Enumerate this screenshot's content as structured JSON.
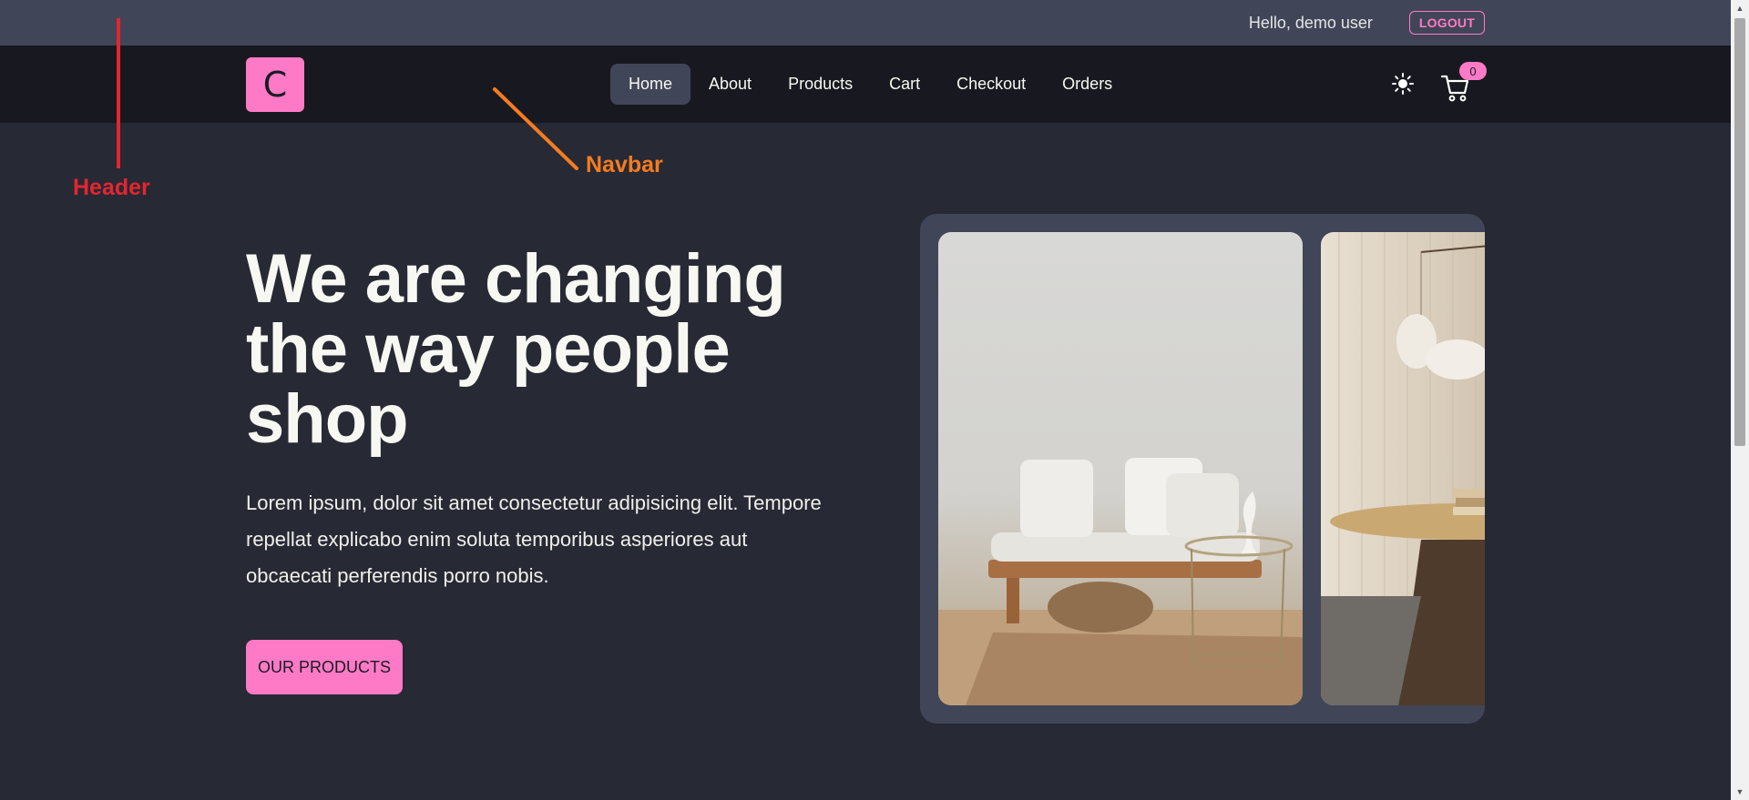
{
  "header": {
    "greeting": "Hello, demo user",
    "logout_label": "LOGOUT"
  },
  "navbar": {
    "logo_letter": "C",
    "links": [
      {
        "label": "Home",
        "active": true
      },
      {
        "label": "About"
      },
      {
        "label": "Products"
      },
      {
        "label": "Cart"
      },
      {
        "label": "Checkout"
      },
      {
        "label": "Orders"
      }
    ],
    "theme_icon": "sun-icon",
    "cart_icon": "cart-icon",
    "cart_count": "0"
  },
  "annotations": {
    "header_label": "Header",
    "navbar_label": "Navbar",
    "header_color": "#e3262f",
    "navbar_color": "#f47c20"
  },
  "hero": {
    "title": "We are changing the way people shop",
    "text": "Lorem ipsum, dolor sit amet consectetur adipisicing elit. Tempore repellat explicabo enim soluta temporibus asperiores aut obcaecati perferendis porro nobis.",
    "cta_label": "OUR PRODUCTS"
  },
  "colors": {
    "accent": "#ff7ac6",
    "background": "#272935",
    "header_bg": "#414558",
    "navbar_bg": "#181920"
  }
}
